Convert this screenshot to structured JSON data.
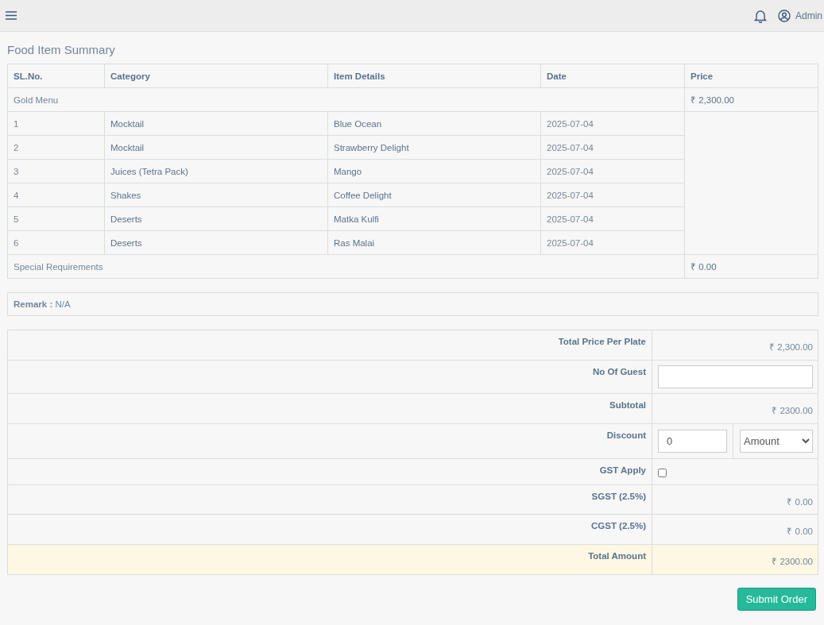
{
  "header": {
    "user": "Admin"
  },
  "summary": {
    "title": "Food Item Summary",
    "columns": [
      "SL.No.",
      "Category",
      "Item Details",
      "Date",
      "Price"
    ],
    "menu_row": {
      "label": "Gold Menu",
      "price": "₹ 2,300.00"
    },
    "rows": [
      {
        "sl": "1",
        "category": "Mocktail",
        "item": "Blue Ocean",
        "date": "2025-07-04"
      },
      {
        "sl": "2",
        "category": "Mocktail",
        "item": "Strawberry Delight",
        "date": "2025-07-04"
      },
      {
        "sl": "3",
        "category": "Juices (Tetra Pack)",
        "item": "Mango",
        "date": "2025-07-04"
      },
      {
        "sl": "4",
        "category": "Shakes",
        "item": "Coffee Delight",
        "date": "2025-07-04"
      },
      {
        "sl": "5",
        "category": "Deserts",
        "item": "Matka Kulfi",
        "date": "2025-07-04"
      },
      {
        "sl": "6",
        "category": "Deserts",
        "item": "Ras Malai",
        "date": "2025-07-04"
      }
    ],
    "special_row": {
      "label": "Special Requirements",
      "price": "₹ 0.00"
    }
  },
  "remark": "**Remark :** N/A",
  "totals": [
    {
      "kind": "amount",
      "label": "Total Price Per Plate",
      "value": "₹ 2,300.00",
      "highlighted": false
    },
    {
      "kind": "input",
      "label": "No Of Guest",
      "highlighted": false
    },
    {
      "kind": "amount",
      "label": "Subtotal",
      "value": "₹ 2300.00",
      "highlighted": false
    },
    {
      "kind": "discount",
      "label": "Discount",
      "value": "0",
      "unit": "Amount",
      "highlighted": false
    },
    {
      "kind": "checkbox",
      "label": "GST Apply",
      "checked": false,
      "highlighted": false
    },
    {
      "kind": "amount",
      "label": "SGST (2.5%)",
      "value": "₹ 0.00",
      "highlighted": false
    },
    {
      "kind": "amount",
      "label": "CGST (2.5%)",
      "value": "₹ 0.00",
      "highlighted": false
    },
    {
      "kind": "amount",
      "label": "Total Amount",
      "value": "₹ 2300.00",
      "highlighted": true
    }
  ],
  "submit": "Submit Order"
}
